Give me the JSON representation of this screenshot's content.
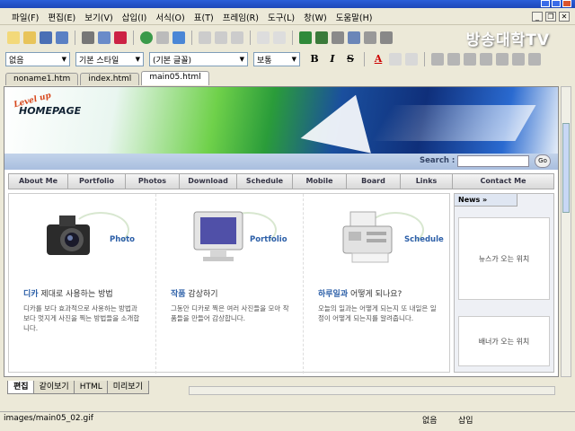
{
  "menu": [
    "파일(F)",
    "편집(E)",
    "보기(V)",
    "삽입(I)",
    "서식(O)",
    "표(T)",
    "프레임(R)",
    "도구(L)",
    "창(W)",
    "도움말(H)"
  ],
  "toolbar": {
    "font_size": "없음",
    "style": "기본 스타일",
    "font": "(기본 글꼴)",
    "paragraph": "보통",
    "bold": "B",
    "italic": "I",
    "underline": "S",
    "font_color": "A"
  },
  "watermark": "방송대학TV",
  "doc_tabs": [
    "noname1.htm",
    "index.html",
    "main05.html"
  ],
  "page": {
    "logo_top": "Level up",
    "logo_main": "HOMEPAGE",
    "search_label": "Search :",
    "search_go": "Go",
    "nav": [
      "About Me",
      "Portfolio",
      "Photos",
      "Download",
      "Schedule",
      "Mobile",
      "Board",
      "Links",
      "Contact Me"
    ],
    "columns": [
      {
        "title": "Photo",
        "heading_bold": "디카",
        "heading_rest": " 제대로 사용하는 방법",
        "body": "디카를 보다 효과적으로 사용하는 방법과 보다 멋지게 사진을 찍는 방법들을 소개합니다."
      },
      {
        "title": "Portfolio",
        "heading_bold": "작품",
        "heading_rest": " 감상하기",
        "body": "그동안 디카로 찍은 여러 사진들을 모아 작품들을 만들어 감상합니다."
      },
      {
        "title": "Schedule",
        "heading_bold": "하루일과",
        "heading_rest": " 어떻게 되나요?",
        "body": "오늘의 일과는 어떻게 되는지 또 내일은 일정이 어떻게 되는지를 알려줍니다."
      }
    ],
    "news_tab": "News »",
    "news_box": "뉴스가 오는 위치",
    "banner_box": "배너가 오는 위치"
  },
  "view_tabs": [
    "편집",
    "같이보기",
    "HTML",
    "미리보기"
  ],
  "status": {
    "path": "images/main05_02.gif",
    "mode1": "없음",
    "mode2": "삽입"
  }
}
